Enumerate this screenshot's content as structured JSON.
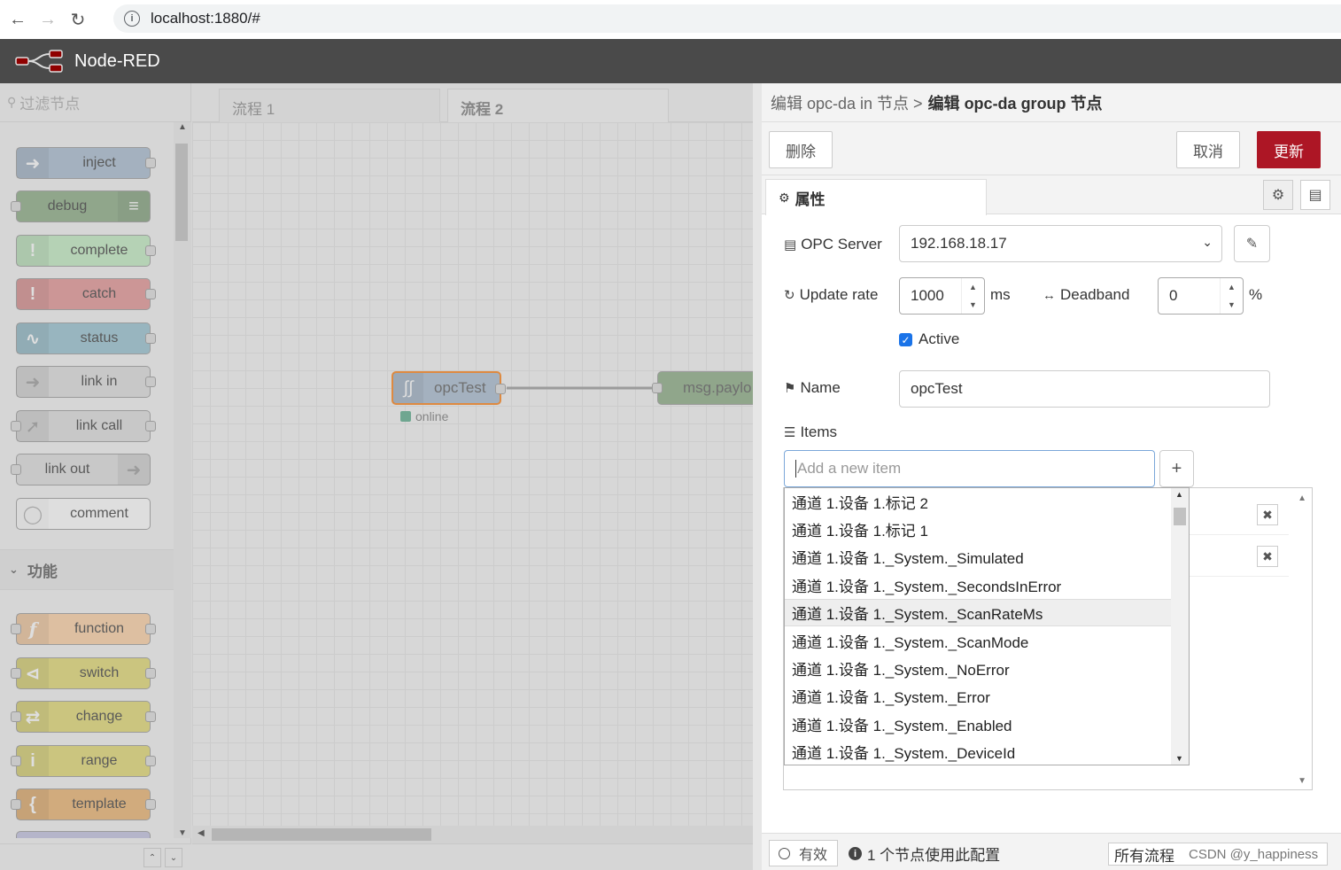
{
  "browser": {
    "url": "localhost:1880/#"
  },
  "app": {
    "title": "Node-RED"
  },
  "palette": {
    "filter_placeholder": "过滤节点",
    "section_common_nodes": [
      {
        "label": "inject",
        "color": "#a6bbcf"
      },
      {
        "label": "debug",
        "color": "#87a980"
      },
      {
        "label": "complete",
        "color": "#c0edc0"
      },
      {
        "label": "catch",
        "color": "#e49191"
      },
      {
        "label": "status",
        "color": "#94c1d0"
      },
      {
        "label": "link in",
        "color": "#dddddd"
      },
      {
        "label": "link call",
        "color": "#dddddd"
      },
      {
        "label": "link out",
        "color": "#dddddd"
      },
      {
        "label": "comment",
        "color": "#ffffff"
      }
    ],
    "section_function_title": "功能",
    "section_function_nodes": [
      {
        "label": "function",
        "color": "#fdd0a2"
      },
      {
        "label": "switch",
        "color": "#e2d96e"
      },
      {
        "label": "change",
        "color": "#e2d96e"
      },
      {
        "label": "range",
        "color": "#e2d96e"
      },
      {
        "label": "template",
        "color": "#ebb16a"
      }
    ]
  },
  "workspace": {
    "tabs": [
      {
        "label": "流程 1",
        "active": false
      },
      {
        "label": "流程 2",
        "active": true
      }
    ],
    "nodes": {
      "opc_node_label": "opcTest",
      "opc_node_status": "online",
      "debug_node_label": "msg.paylo"
    }
  },
  "tray": {
    "breadcrumb_parent": "编辑 opc-da in 节点 >",
    "breadcrumb_current": "编辑 opc-da group 节点",
    "delete_label": "删除",
    "cancel_label": "取消",
    "update_label": "更新",
    "properties_tab": "属性",
    "form": {
      "server_label": "OPC Server",
      "server_value": "192.168.18.17",
      "update_rate_label": "Update rate",
      "update_rate_value": "1000",
      "update_rate_unit": "ms",
      "deadband_label": "Deadband",
      "deadband_value": "0",
      "deadband_unit": "%",
      "active_label": "Active",
      "active_checked": true,
      "name_label": "Name",
      "name_value": "opcTest",
      "items_label": "Items",
      "new_item_placeholder": "Add a new item"
    },
    "dropdown_items": [
      "通道 1.设备 1.标记 2",
      "通道 1.设备 1.标记 1",
      "通道 1.设备 1._System._Simulated",
      "通道 1.设备 1._System._SecondsInError",
      "通道 1.设备 1._System._ScanRateMs",
      "通道 1.设备 1._System._ScanMode",
      "通道 1.设备 1._System._NoError",
      "通道 1.设备 1._System._Error",
      "通道 1.设备 1._System._Enabled",
      "通道 1.设备 1._System._DeviceId"
    ],
    "footer": {
      "enabled_label": "有效",
      "usage_text": "1 个节点使用此配置",
      "scope_label": "所有流程",
      "watermark": "CSDN @y_happiness"
    }
  },
  "colors": {
    "accent": "#ad1625",
    "header": "#4a4a4a",
    "opc_node": "#a6bbcf",
    "opc_border": "#ff7f0e"
  }
}
